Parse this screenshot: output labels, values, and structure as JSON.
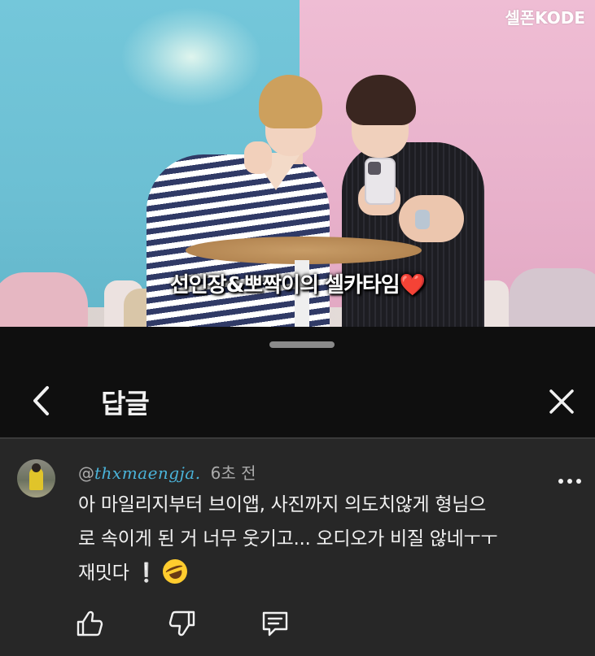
{
  "video": {
    "caption": "선인장&뽀짝이의 셀카타임",
    "caption_emoji": "❤️",
    "channel_logo": "셀폰KODE"
  },
  "sheet": {
    "title": "답글",
    "icons": {
      "back": "chevron-left-icon",
      "close": "close-icon",
      "more": "more-vertical-icon",
      "like": "thumbs-up-icon",
      "dislike": "thumbs-down-icon",
      "reply": "reply-icon"
    }
  },
  "comment": {
    "handle_prefix": "@",
    "handle": "thxmaengja.",
    "time": "6초 전",
    "lines": [
      "아 마일리지부터 브이앱, 사진까지 의도치않게 형님으",
      "로 속이게 된 거 너무 웃기고... 오디오가 비질 않네ㅜㅜ",
      "재밋다"
    ],
    "emoji_1": "❕",
    "emoji_2": "🤣"
  },
  "colors": {
    "background": "#0f0f0f",
    "comment_bg": "#272727",
    "text": "#f1f1f1",
    "muted": "#aaaaaa",
    "handle_accent": "#4ab3d9"
  }
}
